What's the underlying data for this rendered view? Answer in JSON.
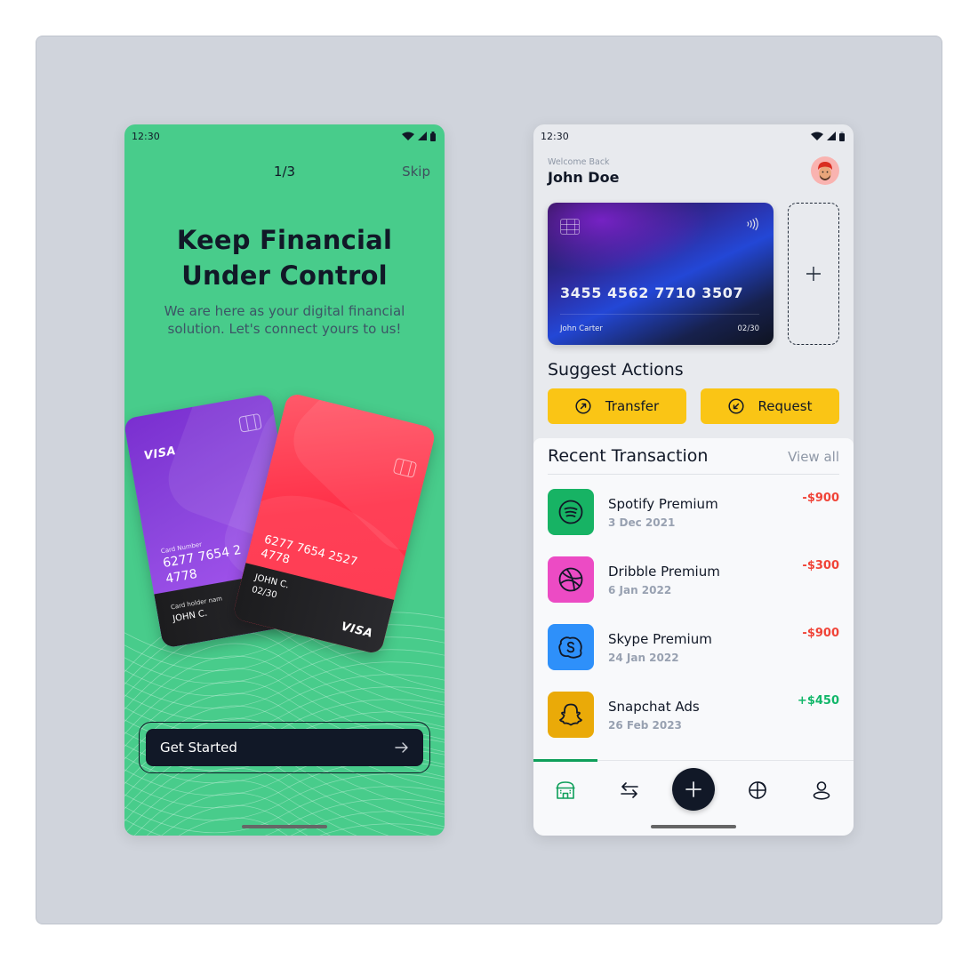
{
  "onboarding": {
    "status_time": "12:30",
    "pager": "1/3",
    "skip_label": "Skip",
    "title_line1": "Keep Financial",
    "title_line2": "Under Control",
    "subtitle": "We are here as your digital financial solution. Let's connect yours to us!",
    "cards": {
      "purple": {
        "brand": "VISA",
        "number_label": "Card Number",
        "number_line1": "6277 7654 2",
        "number_line2": "4778",
        "holder_label": "Card holder nam",
        "holder": "JOHN C."
      },
      "red": {
        "number_line1": "6277 7654 2527",
        "number_line2": "4778",
        "holder": "JOHN C.",
        "expiry": "02/30",
        "brand": "VISA"
      }
    },
    "cta_label": "Get Started",
    "cta_icon": "arrow-right-icon",
    "colors": {
      "background": "#48cc8b",
      "button": "#111827"
    }
  },
  "dashboard": {
    "status_time": "12:30",
    "welcome": "Welcome Back",
    "user_name": "John Doe",
    "card": {
      "number": "3455 4562 7710 3507",
      "holder": "John Carter",
      "expiry": "02/30"
    },
    "add_card_icon": "plus-icon",
    "suggest_title": "Suggest Actions",
    "actions": [
      {
        "label": "Transfer",
        "icon": "arrow-up-right-circle-icon"
      },
      {
        "label": "Request",
        "icon": "arrow-down-left-circle-icon"
      }
    ],
    "transactions_title": "Recent Transaction",
    "view_all": "View all",
    "transactions": [
      {
        "name": "Spotify Premium",
        "date": "3 Dec 2021",
        "amount": "-$900",
        "icon": "spotify-icon",
        "color": "#17b364"
      },
      {
        "name": "Dribble Premium",
        "date": "6 Jan 2022",
        "amount": "-$300",
        "icon": "dribbble-icon",
        "color": "#ec4bc4"
      },
      {
        "name": "Skype Premium",
        "date": "24 Jan 2022",
        "amount": "-$900",
        "icon": "skype-icon",
        "color": "#2e90fa"
      },
      {
        "name": "Snapchat Ads",
        "date": "26 Feb 2023",
        "amount": "+$450",
        "icon": "snapchat-icon",
        "color": "#eaaa08"
      }
    ],
    "nav": [
      {
        "name": "home",
        "icon": "store-icon",
        "active": true
      },
      {
        "name": "transfer",
        "icon": "swap-arrows-icon",
        "active": false
      },
      {
        "name": "add",
        "icon": "plus-icon",
        "active": false
      },
      {
        "name": "analytics",
        "icon": "pie-chart-icon",
        "active": false
      },
      {
        "name": "profile",
        "icon": "user-icon",
        "active": false
      }
    ],
    "colors": {
      "accent": "#fac515",
      "active_nav": "#0e9f5a",
      "negative": "#f04438",
      "positive": "#12b76a"
    }
  }
}
